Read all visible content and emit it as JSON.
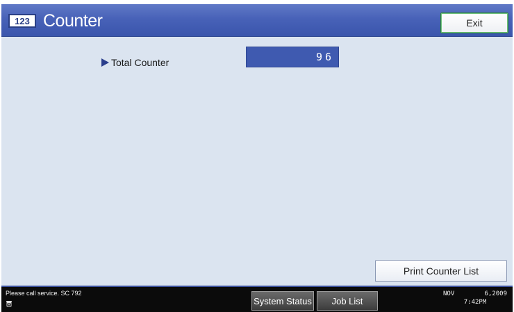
{
  "header": {
    "icon_text": "123",
    "title": "Counter",
    "exit_label": "Exit"
  },
  "main": {
    "counter_label": "Total Counter",
    "counter_value": "96",
    "print_button_label": "Print Counter List"
  },
  "footer": {
    "service_message": "Please call service. SC 792",
    "system_status_label": "System Status",
    "job_list_label": "Job List",
    "date_month": "NOV",
    "date_day_year": "6,2009",
    "time": "7:42PM"
  },
  "icons": {
    "header_icon": "counter-123-icon",
    "arrow": "right-triangle-icon",
    "phone": "phone-icon"
  },
  "colors": {
    "header_blue": "#4862b8",
    "panel_bg": "#dbe4f0",
    "value_box": "#3f5ab0",
    "footer_bg": "#0b0b0b"
  }
}
